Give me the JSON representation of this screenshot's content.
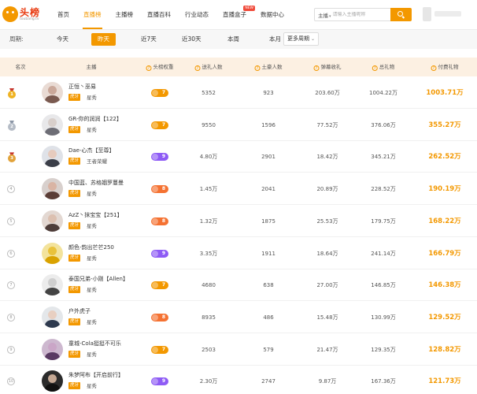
{
  "logo": {
    "text": "头榜",
    "sub": "toubang.tv"
  },
  "nav": [
    {
      "label": "首页",
      "active": false,
      "badge": ""
    },
    {
      "label": "直播榜",
      "active": true,
      "badge": ""
    },
    {
      "label": "主播榜",
      "active": false,
      "badge": ""
    },
    {
      "label": "直播百科",
      "active": false,
      "badge": ""
    },
    {
      "label": "行业动态",
      "active": false,
      "badge": ""
    },
    {
      "label": "直播盒子",
      "active": false,
      "badge": "NEW"
    },
    {
      "label": "数据中心",
      "active": false,
      "badge": ""
    }
  ],
  "search": {
    "select_label": "主播",
    "placeholder": "请输入主播昵称"
  },
  "period": {
    "label": "周期:",
    "tabs": [
      {
        "label": "今天",
        "active": false
      },
      {
        "label": "昨天",
        "active": true
      },
      {
        "label": "近7天",
        "active": false
      },
      {
        "label": "近30天",
        "active": false
      },
      {
        "label": "本周",
        "active": false
      },
      {
        "label": "本月",
        "active": false
      }
    ],
    "more_label": "更多周期"
  },
  "table": {
    "headers": [
      "名次",
      "主播",
      "头榜权重",
      "送礼人数",
      "土豪人数",
      "弹幕收礼",
      "总礼物",
      "付费礼物"
    ],
    "rows": [
      {
        "rank": "1",
        "name": "正恒丶巫易",
        "platform": "虎牙",
        "category": "星秀",
        "weight": "7",
        "weight_color": "#f39800",
        "givers": "5352",
        "tycoons": "923",
        "danmu": "203.60万",
        "total": "1004.22万",
        "paid": "1003.71万"
      },
      {
        "rank": "2",
        "name": "GR-你的润润【122】",
        "platform": "虎牙",
        "category": "星秀",
        "weight": "7",
        "weight_color": "#f39800",
        "givers": "9550",
        "tycoons": "1596",
        "danmu": "77.52万",
        "total": "376.06万",
        "paid": "355.27万"
      },
      {
        "rank": "3",
        "name": "Dae-心杰【至尊】",
        "platform": "虎牙",
        "category": "王者荣耀",
        "weight": "9",
        "weight_color": "#8e5bf5",
        "givers": "4.80万",
        "tycoons": "2901",
        "danmu": "18.42万",
        "total": "345.21万",
        "paid": "262.52万"
      },
      {
        "rank": "4",
        "name": "中国蓝、苏格姻罗蔓曼",
        "platform": "虎牙",
        "category": "星秀",
        "weight": "8",
        "weight_color": "#f57232",
        "givers": "1.45万",
        "tycoons": "2041",
        "danmu": "20.89万",
        "total": "228.52万",
        "paid": "190.19万"
      },
      {
        "rank": "5",
        "name": "AzZ丶抹宝宝【251】",
        "platform": "虎牙",
        "category": "星秀",
        "weight": "8",
        "weight_color": "#f57232",
        "givers": "1.32万",
        "tycoons": "1875",
        "danmu": "25.53万",
        "total": "179.75万",
        "paid": "168.22万"
      },
      {
        "rank": "6",
        "name": "颜色-韵出芒芒250",
        "platform": "虎牙",
        "category": "星秀",
        "weight": "9",
        "weight_color": "#8e5bf5",
        "givers": "3.35万",
        "tycoons": "1911",
        "danmu": "18.64万",
        "total": "241.14万",
        "paid": "166.79万"
      },
      {
        "rank": "7",
        "name": "泰国兄弟-小刚【Allen】",
        "platform": "虎牙",
        "category": "星秀",
        "weight": "7",
        "weight_color": "#f39800",
        "givers": "4680",
        "tycoons": "638",
        "danmu": "27.00万",
        "total": "146.85万",
        "paid": "146.38万"
      },
      {
        "rank": "8",
        "name": "户外虎子",
        "platform": "虎牙",
        "category": "星秀",
        "weight": "8",
        "weight_color": "#f57232",
        "givers": "8935",
        "tycoons": "486",
        "danmu": "15.48万",
        "total": "130.99万",
        "paid": "129.52万"
      },
      {
        "rank": "9",
        "name": "童城-Cola挺挺不可乐",
        "platform": "虎牙",
        "category": "星秀",
        "weight": "7",
        "weight_color": "#f39800",
        "givers": "2503",
        "tycoons": "579",
        "danmu": "21.47万",
        "total": "129.35万",
        "paid": "128.82万"
      },
      {
        "rank": "10",
        "name": "朱梦阿布【开启前行】",
        "platform": "虎牙",
        "category": "星秀",
        "weight": "9",
        "weight_color": "#8e5bf5",
        "givers": "2.30万",
        "tycoons": "2747",
        "danmu": "9.87万",
        "total": "167.36万",
        "paid": "121.73万"
      }
    ]
  }
}
